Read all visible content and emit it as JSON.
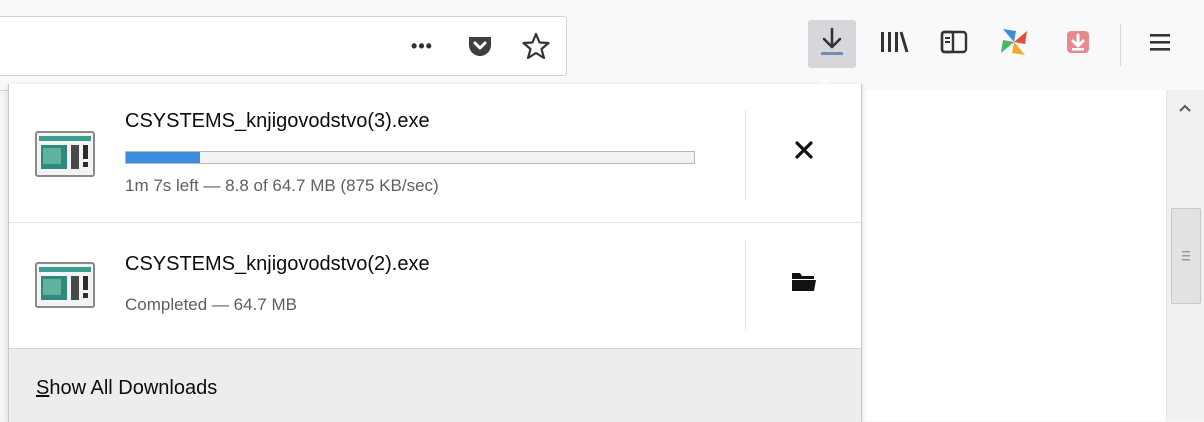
{
  "toolbar": {
    "url_actions": [
      {
        "icon": "more-actions-icon",
        "glyph": "•••"
      },
      {
        "icon": "pocket-icon"
      },
      {
        "icon": "bookmark-star-icon",
        "glyph": "☆"
      }
    ],
    "buttons": [
      {
        "icon": "downloads-icon",
        "active": true
      },
      {
        "icon": "library-icon",
        "glyph": "|||\\"
      },
      {
        "icon": "sidebar-icon"
      },
      {
        "icon": "extension-pinwheel-icon"
      },
      {
        "icon": "extension-download-icon"
      },
      {
        "icon": "hamburger-menu-icon",
        "glyph": "☰"
      }
    ]
  },
  "downloads": {
    "items": [
      {
        "name": "CSYSTEMS_knjigovodstvo(3).exe",
        "progress": 0.13,
        "status": "1m 7s left — 8.8 of 64.7 MB (875 KB/sec)",
        "action_icon": "cancel-icon",
        "action_glyph": "✕"
      },
      {
        "name": "CSYSTEMS_knjigovodstvo(2).exe",
        "status": "Completed — 64.7 MB",
        "action_icon": "open-folder-icon"
      }
    ],
    "footer": {
      "accesskey": "S",
      "rest": "how All Downloads"
    }
  },
  "colors": {
    "progress": "#3b8de0",
    "panel_footer": "#ededf0",
    "toolbar_bg": "#f9f9fa"
  }
}
